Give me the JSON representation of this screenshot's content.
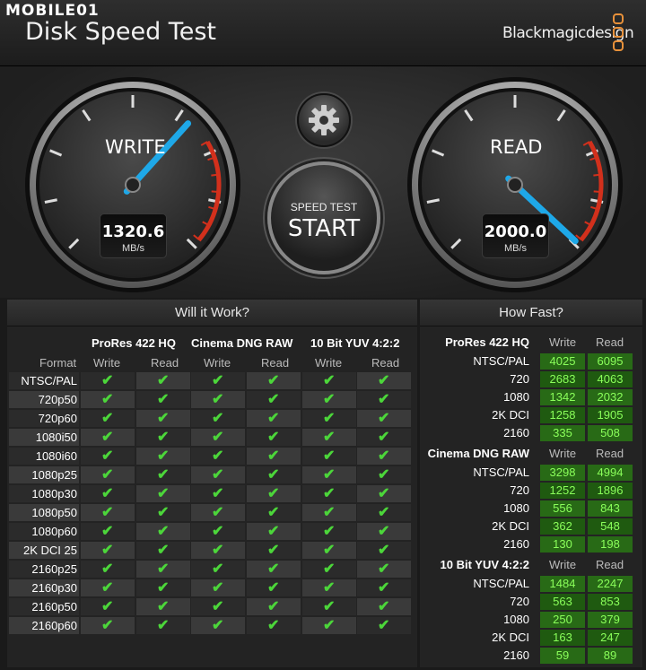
{
  "watermark": "MOBILE01",
  "app_title": "Disk Speed Test",
  "brand": "Blackmagicdesign",
  "gauges": {
    "write": {
      "label": "WRITE",
      "value": "1320.6",
      "unit": "MB/s"
    },
    "read": {
      "label": "READ",
      "value": "2000.0",
      "unit": "MB/s"
    }
  },
  "start_button": {
    "small": "SPEED TEST",
    "big": "START"
  },
  "will_it_work": {
    "title": "Will it Work?",
    "codecs": [
      "ProRes 422 HQ",
      "Cinema DNG RAW",
      "10 Bit YUV 4:2:2"
    ],
    "format_label": "Format",
    "write_label": "Write",
    "read_label": "Read",
    "formats": [
      "NTSC/PAL",
      "720p50",
      "720p60",
      "1080i50",
      "1080i60",
      "1080p25",
      "1080p30",
      "1080p50",
      "1080p60",
      "2K DCI 25",
      "2160p25",
      "2160p30",
      "2160p50",
      "2160p60"
    ],
    "check_glyph": "✔"
  },
  "how_fast": {
    "title": "How Fast?",
    "write_label": "Write",
    "read_label": "Read",
    "groups": [
      {
        "codec": "ProRes 422 HQ",
        "rows": [
          {
            "format": "NTSC/PAL",
            "write": "4025",
            "read": "6095"
          },
          {
            "format": "720",
            "write": "2683",
            "read": "4063"
          },
          {
            "format": "1080",
            "write": "1342",
            "read": "2032"
          },
          {
            "format": "2K DCI",
            "write": "1258",
            "read": "1905"
          },
          {
            "format": "2160",
            "write": "335",
            "read": "508"
          }
        ]
      },
      {
        "codec": "Cinema DNG RAW",
        "rows": [
          {
            "format": "NTSC/PAL",
            "write": "3298",
            "read": "4994"
          },
          {
            "format": "720",
            "write": "1252",
            "read": "1896"
          },
          {
            "format": "1080",
            "write": "556",
            "read": "843"
          },
          {
            "format": "2K DCI",
            "write": "362",
            "read": "548"
          },
          {
            "format": "2160",
            "write": "130",
            "read": "198"
          }
        ]
      },
      {
        "codec": "10 Bit YUV 4:2:2",
        "rows": [
          {
            "format": "NTSC/PAL",
            "write": "1484",
            "read": "2247"
          },
          {
            "format": "720",
            "write": "563",
            "read": "853"
          },
          {
            "format": "1080",
            "write": "250",
            "read": "379"
          },
          {
            "format": "2K DCI",
            "write": "163",
            "read": "247"
          },
          {
            "format": "2160",
            "write": "59",
            "read": "89"
          }
        ]
      }
    ]
  },
  "colors": {
    "accent_needle": "#1ea8e8",
    "redline": "#d2301c",
    "ok_green": "#4cd63a",
    "num_bg": "#286a16"
  }
}
